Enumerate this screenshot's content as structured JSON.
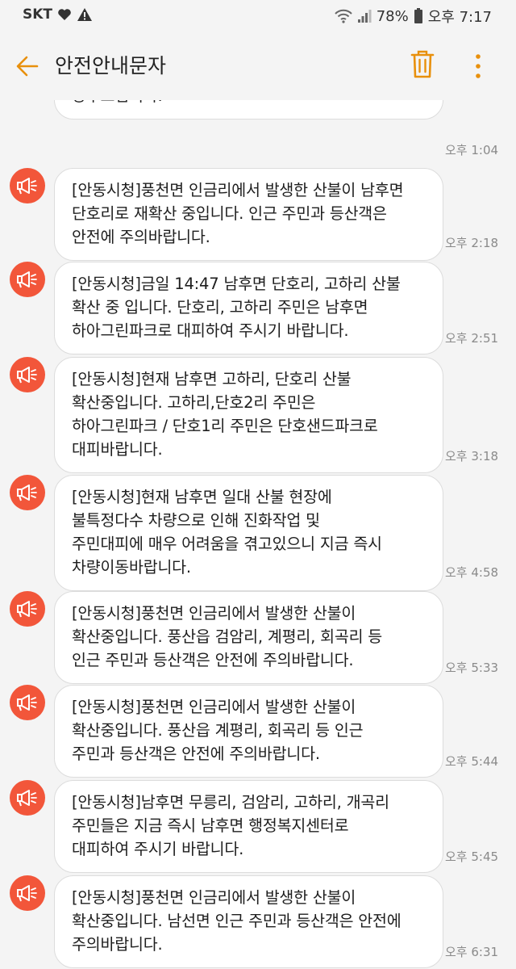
{
  "status": {
    "carrier": "SKT",
    "battery": "78%",
    "clock": "오후 7:17"
  },
  "header": {
    "title": "안전안내문자"
  },
  "messages": [
    {
      "text": "있습니다. 마스크착용, 외출·모임·집회 자제를\n당부드립니다.",
      "time": "오후 1:04"
    },
    {
      "text": "[안동시청]풍천면 인금리에서 발생한 산불이 남후면\n단호리로 재확산 중입니다. 인근 주민과 등산객은\n안전에 주의바랍니다.",
      "time": "오후 2:18"
    },
    {
      "text": "[안동시청]금일 14:47 남후면 단호리, 고하리 산불\n확산 중 입니다. 단호리, 고하리 주민은 남후면\n하아그린파크로 대피하여 주시기 바랍니다.",
      "time": "오후 2:51"
    },
    {
      "text": "[안동시청]현재 남후면 고하리, 단호리 산불\n확산중입니다. 고하리,단호2리 주민은\n하아그린파크 / 단호1리 주민은 단호샌드파크로\n대피바랍니다.",
      "time": "오후 3:18"
    },
    {
      "text": "[안동시청]현재 남후면 일대 산불 현장에\n불특정다수 차량으로 인해 진화작업 및\n주민대피에 매우 어려움을 겪고있으니 지금 즉시\n차량이동바랍니다.",
      "time": "오후 4:58"
    },
    {
      "text": "[안동시청]풍천면 인금리에서 발생한 산불이\n확산중입니다. 풍산읍 검암리, 계평리, 회곡리 등\n인근 주민과 등산객은 안전에 주의바랍니다.",
      "time": "오후 5:33"
    },
    {
      "text": "[안동시청]풍천면 인금리에서 발생한 산불이\n확산중입니다. 풍산읍 계평리, 회곡리 등 인근\n주민과 등산객은 안전에 주의바랍니다.",
      "time": "오후 5:44"
    },
    {
      "text": "[안동시청]남후면 무릉리, 검암리, 고하리, 개곡리\n주민들은 지금 즉시 남후면 행정복지센터로\n대피하여 주시기 바랍니다.",
      "time": "오후 5:45"
    },
    {
      "text": "[안동시청]풍천면 인금리에서 발생한 산불이\n확산중입니다. 남선면 인근 주민과 등산객은 안전에\n주의바랍니다.",
      "time": "오후 6:31"
    }
  ],
  "icons": {
    "back": "arrow-left-icon",
    "trash": "trash-icon",
    "more": "more-vertical-icon",
    "avatar": "megaphone-icon"
  },
  "colors": {
    "accent": "#e8900c",
    "avatar": "#f2563a"
  }
}
